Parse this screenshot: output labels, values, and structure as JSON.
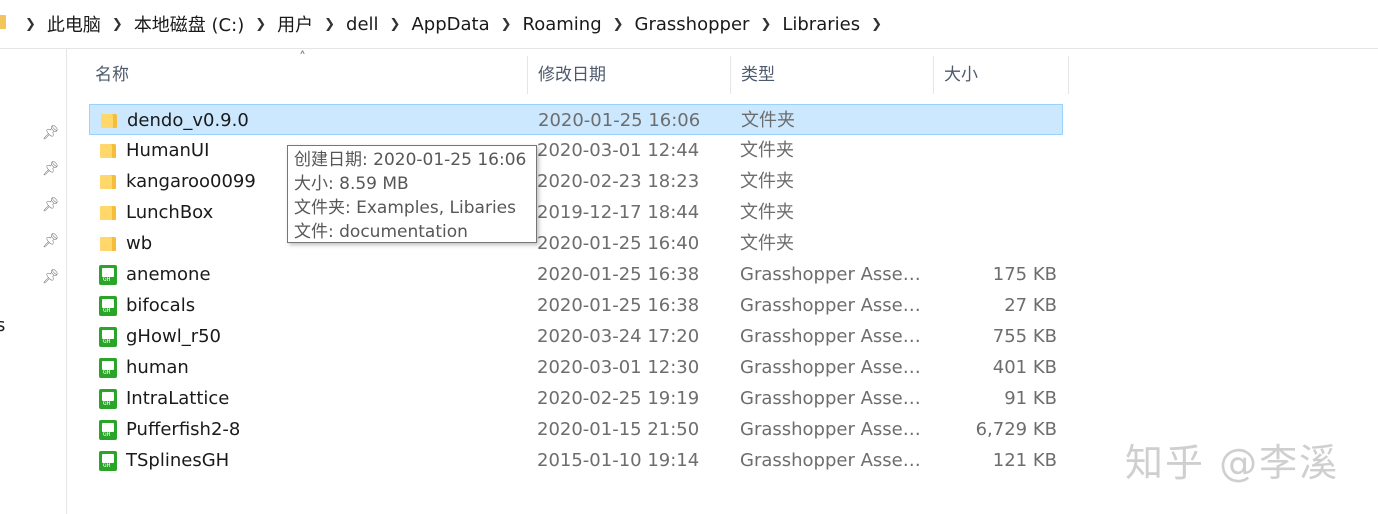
{
  "breadcrumb": [
    "此电脑",
    "本地磁盘 (C:)",
    "用户",
    "dell",
    "AppData",
    "Roaming",
    "Grasshopper",
    "Libraries"
  ],
  "nav": {
    "cut_text": "s"
  },
  "columns": {
    "name": "名称",
    "date": "修改日期",
    "type": "类型",
    "size": "大小"
  },
  "files": [
    {
      "name": "dendo_v0.9.0",
      "date": "2020-01-25 16:06",
      "type": "文件夹",
      "size": "",
      "icon": "folder-icon",
      "selected": true
    },
    {
      "name": "HumanUI",
      "date": "2020-03-01 12:44",
      "type": "文件夹",
      "size": "",
      "icon": "folder-icon"
    },
    {
      "name": "kangaroo0099",
      "date": "2020-02-23 18:23",
      "type": "文件夹",
      "size": "",
      "icon": "folder-icon"
    },
    {
      "name": "LunchBox",
      "date": "2019-12-17 18:44",
      "type": "文件夹",
      "size": "",
      "icon": "folder-icon"
    },
    {
      "name": "wb",
      "date": "2020-01-25 16:40",
      "type": "文件夹",
      "size": "",
      "icon": "folder-icon"
    },
    {
      "name": "anemone",
      "date": "2020-01-25 16:38",
      "type": "Grasshopper Assem...",
      "size": "175 KB",
      "icon": "gha-file-icon"
    },
    {
      "name": "bifocals",
      "date": "2020-01-25 16:38",
      "type": "Grasshopper Assem...",
      "size": "27 KB",
      "icon": "gha-file-icon"
    },
    {
      "name": "gHowl_r50",
      "date": "2020-03-24 17:20",
      "type": "Grasshopper Assem...",
      "size": "755 KB",
      "icon": "gha-file-icon"
    },
    {
      "name": "human",
      "date": "2020-03-01 12:30",
      "type": "Grasshopper Assem...",
      "size": "401 KB",
      "icon": "gha-file-icon"
    },
    {
      "name": "IntraLattice",
      "date": "2020-02-25 19:19",
      "type": "Grasshopper Assem...",
      "size": "91 KB",
      "icon": "gha-file-icon"
    },
    {
      "name": "Pufferfish2-8",
      "date": "2020-01-15 21:50",
      "type": "Grasshopper Assem...",
      "size": "6,729 KB",
      "icon": "gha-file-icon"
    },
    {
      "name": "TSplinesGH",
      "date": "2015-01-10 19:14",
      "type": "Grasshopper Assem...",
      "size": "121 KB",
      "icon": "gha-file-icon"
    }
  ],
  "tooltip": {
    "lines": [
      "创建日期: 2020-01-25 16:06",
      "大小: 8.59 MB",
      "文件夹: Examples, Libaries",
      "文件: documentation"
    ]
  },
  "watermark": "知乎 @李溪",
  "colors": {
    "selection_bg": "#cce8ff",
    "selection_border": "#99d1ff",
    "folder": "#ffd76b",
    "gh_green": "#2aa52a"
  }
}
